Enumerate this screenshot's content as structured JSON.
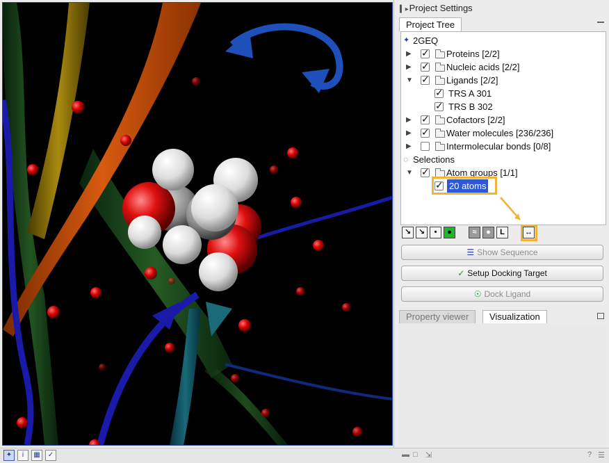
{
  "settings": {
    "title": "Project Settings"
  },
  "tabs_top": [
    {
      "label": "Project Tree",
      "active": true
    }
  ],
  "tree": {
    "root": "2GEQ",
    "items": [
      {
        "label": "Proteins [2/2]",
        "checked": true,
        "expander": "collapsed",
        "folder": true
      },
      {
        "label": "Nucleic acids [2/2]",
        "checked": true,
        "expander": "collapsed",
        "folder": true
      },
      {
        "label": "Ligands [2/2]",
        "checked": true,
        "expander": "expanded",
        "folder": true
      },
      {
        "label": "TRS A 301",
        "checked": true,
        "child": true
      },
      {
        "label": "TRS B 302",
        "checked": true,
        "child": true
      },
      {
        "label": "Cofactors [2/2]",
        "checked": true,
        "expander": "collapsed",
        "folder": true
      },
      {
        "label": "Water molecules [236/236]",
        "checked": true,
        "expander": "collapsed",
        "folder": true
      },
      {
        "label": "Intermolecular bonds [0/8]",
        "checked": false,
        "expander": "collapsed",
        "folder": true
      }
    ],
    "selections": {
      "label": "Selections",
      "group": {
        "label": "Atom groups [1/1]",
        "checked": true
      },
      "selected_item": {
        "label": "20 atoms",
        "checked": true
      }
    }
  },
  "buttons": {
    "show_sequence": "Show Sequence",
    "setup_docking": "Setup Docking Target",
    "dock_ligand": "Dock Ligand"
  },
  "tabs_bottom": [
    {
      "label": "Property viewer",
      "active": false
    },
    {
      "label": "Visualization",
      "active": true
    }
  ],
  "status_bar": {
    "help": "?"
  },
  "colors": {
    "accent_highlight": "#f0b33a",
    "selection": "#2d58d7",
    "viewport_bg": "#000000"
  }
}
